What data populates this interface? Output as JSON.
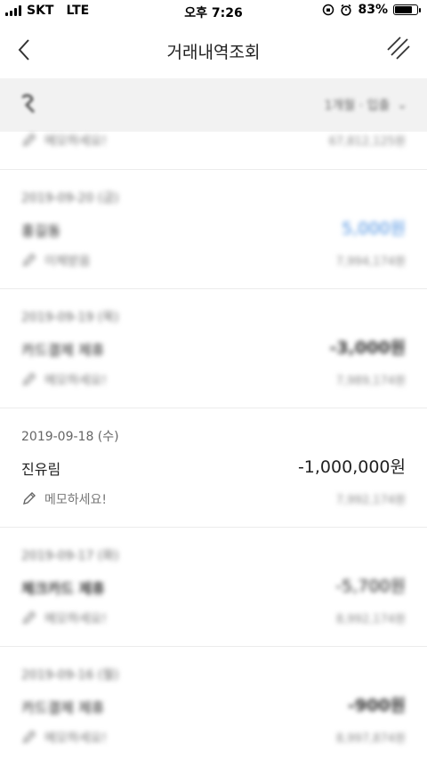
{
  "status_bar": {
    "carrier": "SKT",
    "network": "LTE",
    "time": "오후 7:26",
    "battery_percent": "83%",
    "battery_level": 0.83
  },
  "header": {
    "title": "거래내역조회"
  },
  "account_bar": {
    "selector_label": "1개월 · 입출"
  },
  "partial_row": {
    "memo": "메모하세요!",
    "balance": "67,812,125원"
  },
  "transactions": [
    {
      "date": "2019-09-20 (금)",
      "name": "홍길동",
      "amount": "5,000원",
      "amount_style": "blue",
      "memo": "이체받음",
      "balance": "7,994,174원"
    },
    {
      "date": "2019-09-19 (목)",
      "name": "카드결제 제휴",
      "amount": "-3,000원",
      "amount_style": "dark",
      "memo": "메모하세요!",
      "balance": "7,989,174원"
    },
    {
      "date": "2019-09-18 (수)",
      "name": "진유림",
      "amount": "-1,000,000원",
      "amount_style": "clear",
      "memo": "메모하세요!",
      "balance": "7,992,174원"
    },
    {
      "date": "2019-09-17 (화)",
      "name": "체크카드 제휴",
      "amount": "-5,700원",
      "amount_style": "dark",
      "memo": "메모하세요!",
      "balance": "8,992,174원"
    },
    {
      "date": "2019-09-16 (월)",
      "name": "카드결제 제휴",
      "amount": "-900원",
      "amount_style": "dark",
      "memo": "메모하세요!",
      "balance": "8,997,874원"
    }
  ]
}
